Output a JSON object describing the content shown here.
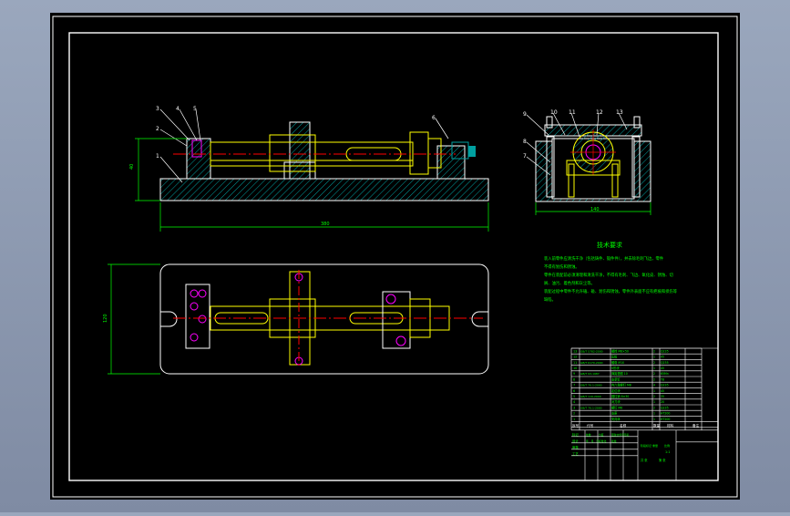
{
  "colors": {
    "window_bg": "#8a96ad",
    "canvas": "#000000",
    "frame": "#ffffff",
    "part": "#ffff00",
    "hatch": "#00a0a0",
    "centerline": "#ff0000",
    "dimension": "#00ff00",
    "outline": "#ffffff",
    "magenta": "#ff00ff",
    "notes": "#00ff00",
    "table_text": "#00ff00"
  },
  "drawing": {
    "tech_title": "技术要求",
    "tech_notes": [
      "装入前零件应清洗干净（包括铸件、锻件件），并去除毛刺飞边，零件",
      "不得有划伤和锈蚀。",
      "零件在装配前必须清理和清洗干净，不得有毛刺、飞边、氧化皮、锈蚀、切",
      "屑、油污、着色剂和灰尘等。",
      "装配过程中零件不允许磕、碰、划伤和锈蚀，零件外表面不应有疤痕和损伤等",
      "缺陷。"
    ],
    "front_view": {
      "balloons": [
        "3",
        "4",
        "5",
        "2",
        "1",
        "6"
      ],
      "dim_height": "40",
      "dim_width": "380"
    },
    "side_view": {
      "balloons": [
        "9",
        "10",
        "11",
        "12",
        "13",
        "8",
        "7"
      ],
      "dim_width": "140"
    },
    "top_view": {
      "dim_height": "120"
    },
    "title_block": {
      "header_cols": [
        "序号",
        "代号",
        "名称",
        "数量",
        "材料",
        "备注"
      ],
      "parts": [
        {
          "no": "13",
          "code": "GB/T 5782-2000",
          "name": "螺栓 M8×50",
          "qty": "2",
          "mat": "Q235"
        },
        {
          "no": "12",
          "code": "",
          "name": "压板",
          "qty": "1",
          "mat": "45"
        },
        {
          "no": "11",
          "code": "GB/T 6170-2000",
          "name": "螺母 M10",
          "qty": "2",
          "mat": "Q235"
        },
        {
          "no": "10",
          "code": "",
          "name": "V形块",
          "qty": "1",
          "mat": "45"
        },
        {
          "no": "9",
          "code": "GB/T 93-1987",
          "name": "弹簧垫圈 10",
          "qty": "2",
          "mat": "65Mn"
        },
        {
          "no": "8",
          "code": "",
          "name": "支承钉",
          "qty": "2",
          "mat": "T8"
        },
        {
          "no": "7",
          "code": "GB/T 70.1-2000",
          "name": "内六角螺钉 M8",
          "qty": "4",
          "mat": "Q235"
        },
        {
          "no": "6",
          "code": "",
          "name": "定位块",
          "qty": "1",
          "mat": "45"
        },
        {
          "no": "5",
          "code": "GB/T 119-2000",
          "name": "圆柱销 8×30",
          "qty": "2",
          "mat": "35"
        },
        {
          "no": "4",
          "code": "",
          "name": "对刀块",
          "qty": "1",
          "mat": "20"
        },
        {
          "no": "3",
          "code": "GB/T 70.1-2000",
          "name": "螺钉 M6",
          "qty": "2",
          "mat": "Q235"
        },
        {
          "no": "2",
          "code": "",
          "name": "支座",
          "qty": "1",
          "mat": "HT200"
        },
        {
          "no": "1",
          "code": "",
          "name": "夹具体",
          "qty": "1",
          "mat": "HT200"
        }
      ],
      "sign_rows": [
        "标记",
        "设计",
        "审核",
        "工艺"
      ],
      "sign_extra": [
        "处数",
        "分区",
        "更改文件号",
        "签名",
        "年、月、日",
        "标准化",
        "批准"
      ],
      "scale_labels": [
        "阶段标记",
        "重量",
        "比例"
      ],
      "scale_value": "1:1",
      "sheet_info": [
        "共 张",
        "第 张"
      ]
    }
  }
}
